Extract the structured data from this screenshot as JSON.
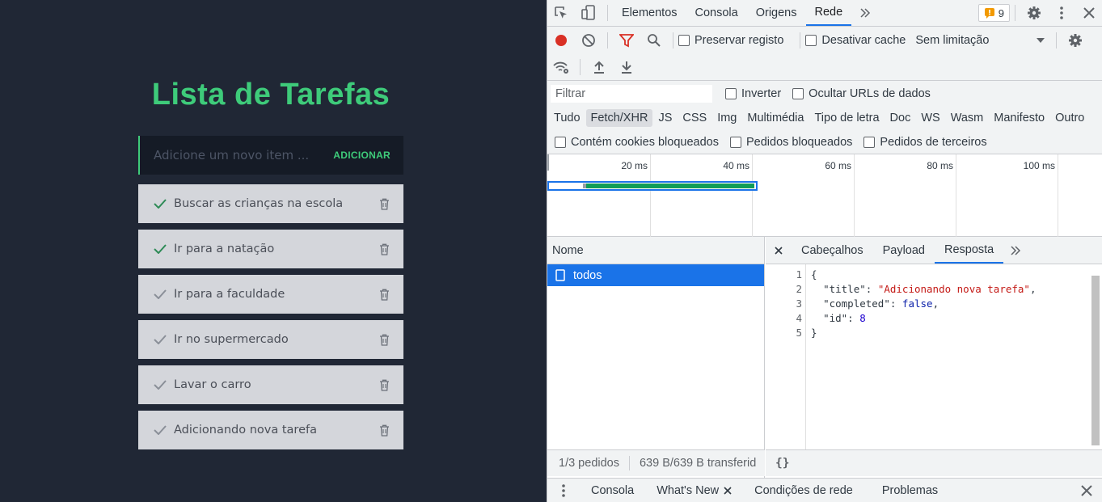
{
  "app": {
    "title": "Lista de Tarefas",
    "input_placeholder": "Adicione um novo item ...",
    "add_label": "ADICIONAR",
    "tasks": [
      {
        "label": "Buscar as crianças na escola",
        "completed": true
      },
      {
        "label": "Ir para a natação",
        "completed": true
      },
      {
        "label": "Ir para a faculdade",
        "completed": false
      },
      {
        "label": "Ir no supermercado",
        "completed": false
      },
      {
        "label": "Lavar o carro",
        "completed": false
      },
      {
        "label": "Adicionando nova tarefa",
        "completed": false
      }
    ],
    "colors": {
      "accent": "#3ecb7a",
      "background": "#202735",
      "card": "#d4d6db"
    }
  },
  "devtools": {
    "tabs": [
      "Elementos",
      "Consola",
      "Origens",
      "Rede"
    ],
    "active_tab": "Rede",
    "issues_count": "9",
    "toolbar": {
      "preserve_log": "Preservar registo",
      "disable_cache": "Desativar cache",
      "throttling": "Sem limitação"
    },
    "filter": {
      "placeholder": "Filtrar",
      "invert": "Inverter",
      "hide_data_urls": "Ocultar URLs de dados"
    },
    "types": [
      "Tudo",
      "Fetch/XHR",
      "JS",
      "CSS",
      "Img",
      "Multimédia",
      "Tipo de letra",
      "Doc",
      "WS",
      "Wasm",
      "Manifesto",
      "Outro"
    ],
    "active_type": "Fetch/XHR",
    "cookie_filters": {
      "blocked_cookies": "Contém cookies bloqueados",
      "blocked_requests": "Pedidos bloqueados",
      "third_party": "Pedidos de terceiros"
    },
    "timeline_ticks": [
      "20 ms",
      "40 ms",
      "60 ms",
      "80 ms",
      "100 ms"
    ],
    "request_list": {
      "header": "Nome",
      "items": [
        "todos"
      ],
      "status_requests": "1/3 pedidos",
      "status_transferred": "639 B/639 B transferid"
    },
    "detail": {
      "tabs": [
        "Cabeçalhos",
        "Payload",
        "Resposta"
      ],
      "active_tab": "Resposta",
      "line_numbers": [
        "1",
        "2",
        "3",
        "4",
        "5"
      ],
      "response": {
        "open": "{",
        "title_key": "\"title\"",
        "title_value": "\"Adicionando nova tarefa\"",
        "completed_key": "\"completed\"",
        "completed_value": "false",
        "id_key": "\"id\"",
        "id_value": "8",
        "close": "}"
      },
      "pretty_print": "{}"
    },
    "drawer": {
      "tabs": [
        "Consola",
        "What's New",
        "Condições de rede",
        "Problemas"
      ]
    }
  }
}
